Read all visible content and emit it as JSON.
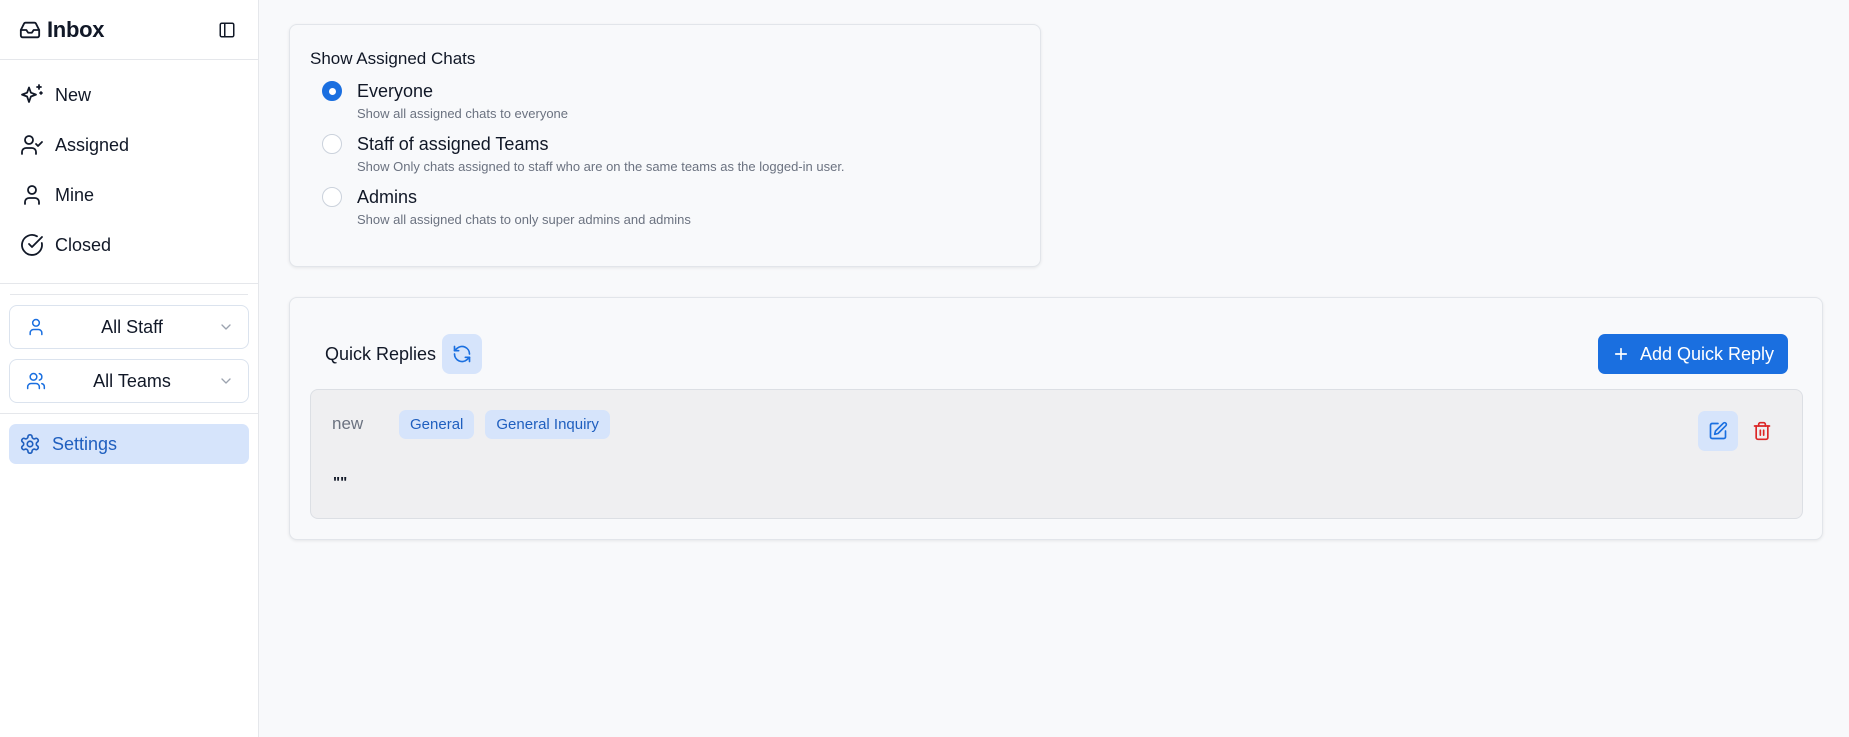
{
  "sidebar": {
    "title": "Inbox",
    "nav": [
      {
        "label": "New",
        "icon": "sparkles-icon"
      },
      {
        "label": "Assigned",
        "icon": "user-check-icon"
      },
      {
        "label": "Mine",
        "icon": "user-icon"
      },
      {
        "label": "Closed",
        "icon": "check-circle-icon"
      }
    ],
    "filters": [
      {
        "label": "All Staff",
        "icon": "user-icon"
      },
      {
        "label": "All Teams",
        "icon": "users-icon"
      }
    ],
    "settings_label": "Settings"
  },
  "assigned_chats": {
    "title": "Show Assigned Chats",
    "selected": "Everyone",
    "options": [
      {
        "label": "Everyone",
        "desc": "Show all assigned chats to everyone"
      },
      {
        "label": "Staff of assigned Teams",
        "desc": "Show Only chats assigned to staff who are on the same teams as the logged-in user."
      },
      {
        "label": "Admins",
        "desc": "Show all assigned chats to only super admins and admins"
      }
    ]
  },
  "quick_replies": {
    "title": "Quick Replies",
    "add_label": "Add Quick Reply",
    "items": [
      {
        "name": "new",
        "tags": [
          "General",
          "General Inquiry"
        ],
        "body": "\"\""
      }
    ]
  },
  "colors": {
    "accent": "#1a6fe0",
    "accent_soft": "#d6e4fb",
    "danger": "#dc2626"
  }
}
